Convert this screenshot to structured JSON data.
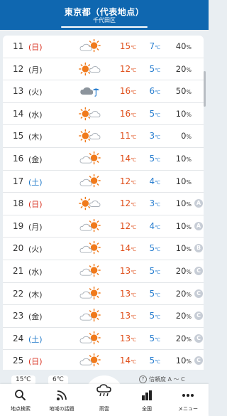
{
  "header": {
    "title": "東京都（代表地点）",
    "subtitle": "千代田区"
  },
  "rows": [
    {
      "day": "11",
      "dow": "(日)",
      "dow_type": "sun",
      "weather": "cloudy-sunny",
      "hi": "15",
      "lo": "7",
      "pop": "40",
      "rel": ""
    },
    {
      "day": "12",
      "dow": "(月)",
      "dow_type": "wd",
      "weather": "sunny-cloudy",
      "hi": "12",
      "lo": "5",
      "pop": "20",
      "rel": ""
    },
    {
      "day": "13",
      "dow": "(火)",
      "dow_type": "wd",
      "weather": "cloudy-rain",
      "hi": "16",
      "lo": "6",
      "pop": "50",
      "rel": ""
    },
    {
      "day": "14",
      "dow": "(水)",
      "dow_type": "wd",
      "weather": "sunny-cloudy",
      "hi": "16",
      "lo": "5",
      "pop": "10",
      "rel": ""
    },
    {
      "day": "15",
      "dow": "(木)",
      "dow_type": "wd",
      "weather": "sunny-cloudy",
      "hi": "11",
      "lo": "3",
      "pop": "0",
      "rel": ""
    },
    {
      "day": "16",
      "dow": "(金)",
      "dow_type": "wd",
      "weather": "cloudy-sunny",
      "hi": "14",
      "lo": "5",
      "pop": "10",
      "rel": ""
    },
    {
      "day": "17",
      "dow": "(土)",
      "dow_type": "sat",
      "weather": "cloudy-sunny",
      "hi": "12",
      "lo": "4",
      "pop": "10",
      "rel": ""
    },
    {
      "day": "18",
      "dow": "(日)",
      "dow_type": "sun",
      "weather": "sunny-cloudy",
      "hi": "12",
      "lo": "3",
      "pop": "10",
      "rel": "A"
    },
    {
      "day": "19",
      "dow": "(月)",
      "dow_type": "wd",
      "weather": "cloudy-sunny",
      "hi": "12",
      "lo": "4",
      "pop": "10",
      "rel": "A"
    },
    {
      "day": "20",
      "dow": "(火)",
      "dow_type": "wd",
      "weather": "cloudy-sunny",
      "hi": "14",
      "lo": "5",
      "pop": "10",
      "rel": "B"
    },
    {
      "day": "21",
      "dow": "(水)",
      "dow_type": "wd",
      "weather": "cloudy-sunny",
      "hi": "13",
      "lo": "5",
      "pop": "20",
      "rel": "C"
    },
    {
      "day": "22",
      "dow": "(木)",
      "dow_type": "wd",
      "weather": "cloudy-sunny",
      "hi": "13",
      "lo": "5",
      "pop": "20",
      "rel": "C"
    },
    {
      "day": "23",
      "dow": "(金)",
      "dow_type": "wd",
      "weather": "cloudy-sunny",
      "hi": "13",
      "lo": "5",
      "pop": "20",
      "rel": "C"
    },
    {
      "day": "24",
      "dow": "(土)",
      "dow_type": "sat",
      "weather": "cloudy-sunny",
      "hi": "13",
      "lo": "5",
      "pop": "20",
      "rel": "C"
    },
    {
      "day": "25",
      "dow": "(日)",
      "dow_type": "sun",
      "weather": "cloudy-sunny",
      "hi": "14",
      "lo": "5",
      "pop": "10",
      "rel": "C"
    }
  ],
  "units": {
    "temp": "℃",
    "pop": "%"
  },
  "below": {
    "pill1": "15℃",
    "pill2": "6℃",
    "legend_icon": "?",
    "legend_text": "信頼度 A ～ C"
  },
  "tabs": [
    {
      "label": "地点検索",
      "icon": "search-icon"
    },
    {
      "label": "地域の話題",
      "icon": "signal-icon"
    },
    {
      "label": "雨雲",
      "icon": "rain-cloud-icon"
    },
    {
      "label": "全国",
      "icon": "bar-chart-icon"
    },
    {
      "label": "メニュー",
      "icon": "menu-dots-icon"
    }
  ],
  "colors": {
    "header": "#0f67b0",
    "sun": "#f07a1c",
    "hi": "#e0501c",
    "lo": "#2a7fd0",
    "sat": "#1e78c8",
    "sun_day": "#d9301f"
  }
}
